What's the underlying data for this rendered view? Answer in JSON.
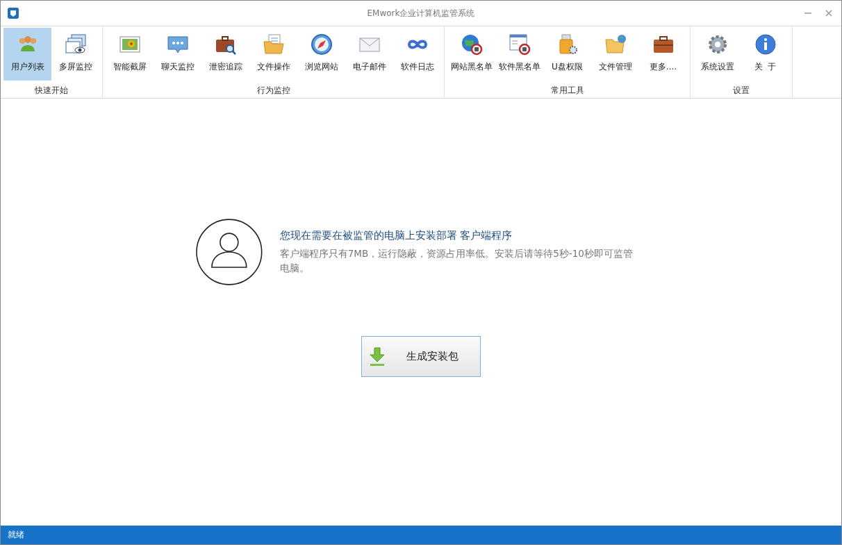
{
  "window": {
    "title": "EMwork企业计算机监管系统"
  },
  "ribbon": [
    {
      "label": "快速开始",
      "items": [
        {
          "label": "用户列表",
          "kind": "users",
          "selected": true
        },
        {
          "label": "多屏监控",
          "kind": "screens",
          "selected": false
        }
      ]
    },
    {
      "label": "行为监控",
      "items": [
        {
          "label": "智能截屏",
          "kind": "picture",
          "selected": false
        },
        {
          "label": "聊天监控",
          "kind": "chat",
          "selected": false
        },
        {
          "label": "泄密追踪",
          "kind": "case-search",
          "selected": false
        },
        {
          "label": "文件操作",
          "kind": "folder-doc",
          "selected": false
        },
        {
          "label": "浏览网站",
          "kind": "compass",
          "selected": false
        },
        {
          "label": "电子邮件",
          "kind": "mail",
          "selected": false
        },
        {
          "label": "软件日志",
          "kind": "infinity",
          "selected": false
        }
      ]
    },
    {
      "label": "常用工具",
      "items": [
        {
          "label": "网站黑名单",
          "kind": "globe-block",
          "selected": false
        },
        {
          "label": "软件黑名单",
          "kind": "window-block",
          "selected": false
        },
        {
          "label": "U盘权限",
          "kind": "usb",
          "selected": false
        },
        {
          "label": "文件管理",
          "kind": "folder-globe",
          "selected": false
        },
        {
          "label": "更多....",
          "kind": "case",
          "selected": false
        }
      ]
    },
    {
      "label": "设置",
      "items": [
        {
          "label": "系统设置",
          "kind": "gear",
          "selected": false
        },
        {
          "label": "关  于",
          "kind": "info",
          "selected": false
        }
      ]
    }
  ],
  "notice": {
    "title": "您现在需要在被监管的电脑上安装部署 客户端程序",
    "body": "客户端程序只有7MB，运行隐蔽，资源占用率低。安装后请等待5秒-10秒即可监管电脑。"
  },
  "action_button": {
    "label": "生成安装包"
  },
  "status_bar": {
    "text": "就绪"
  }
}
